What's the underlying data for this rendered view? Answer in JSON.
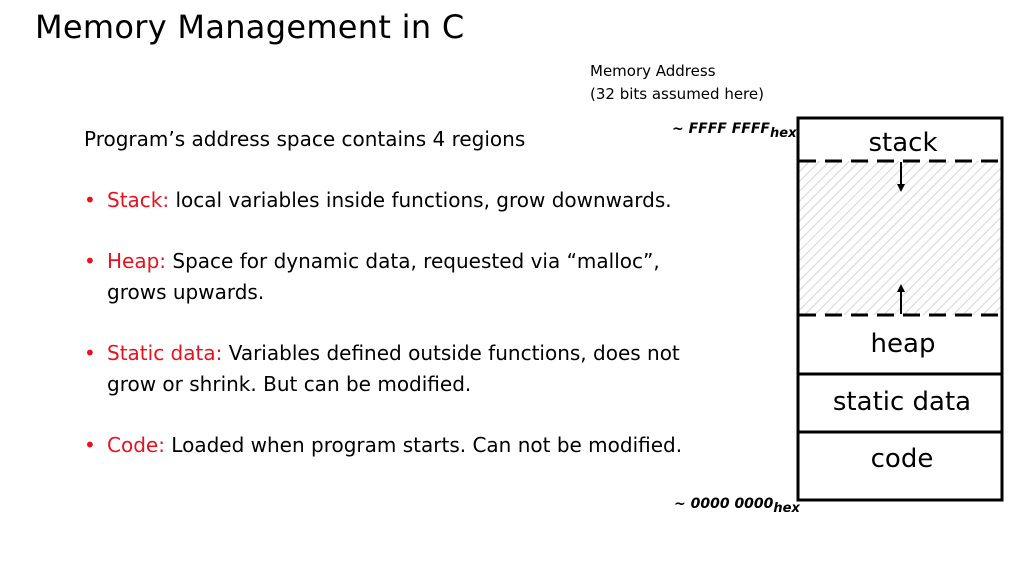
{
  "slide": {
    "title": "Memory Management in C",
    "address_caption": {
      "line1": "Memory Address",
      "line2": "(32 bits assumed here)"
    },
    "intro": "Program’s address space contains 4 regions",
    "bullets": [
      {
        "term": "Stack:",
        "text": " local variables inside functions, grow downwards."
      },
      {
        "term": "Heap:",
        "text": " Space for dynamic data, requested via “malloc”, grows upwards."
      },
      {
        "term": "Static data:",
        "text": " Variables defined outside functions, does not grow or shrink. But can be modified."
      },
      {
        "term": "Code:",
        "text": " Loaded when program starts. Can not be modified."
      }
    ],
    "bullet_glyph": "•",
    "accent_color": "#e8111d"
  },
  "diagram": {
    "high_address": {
      "value": "~ FFFF FFFF",
      "suffix": "hex"
    },
    "low_address": {
      "value": "~ 0000 0000",
      "suffix": "hex"
    },
    "regions": [
      {
        "label": "stack",
        "grows": "down"
      },
      {
        "label": "",
        "fill": "hatched-free-space"
      },
      {
        "label": "heap",
        "grows": "up"
      },
      {
        "label": "static data"
      },
      {
        "label": "code"
      }
    ]
  }
}
